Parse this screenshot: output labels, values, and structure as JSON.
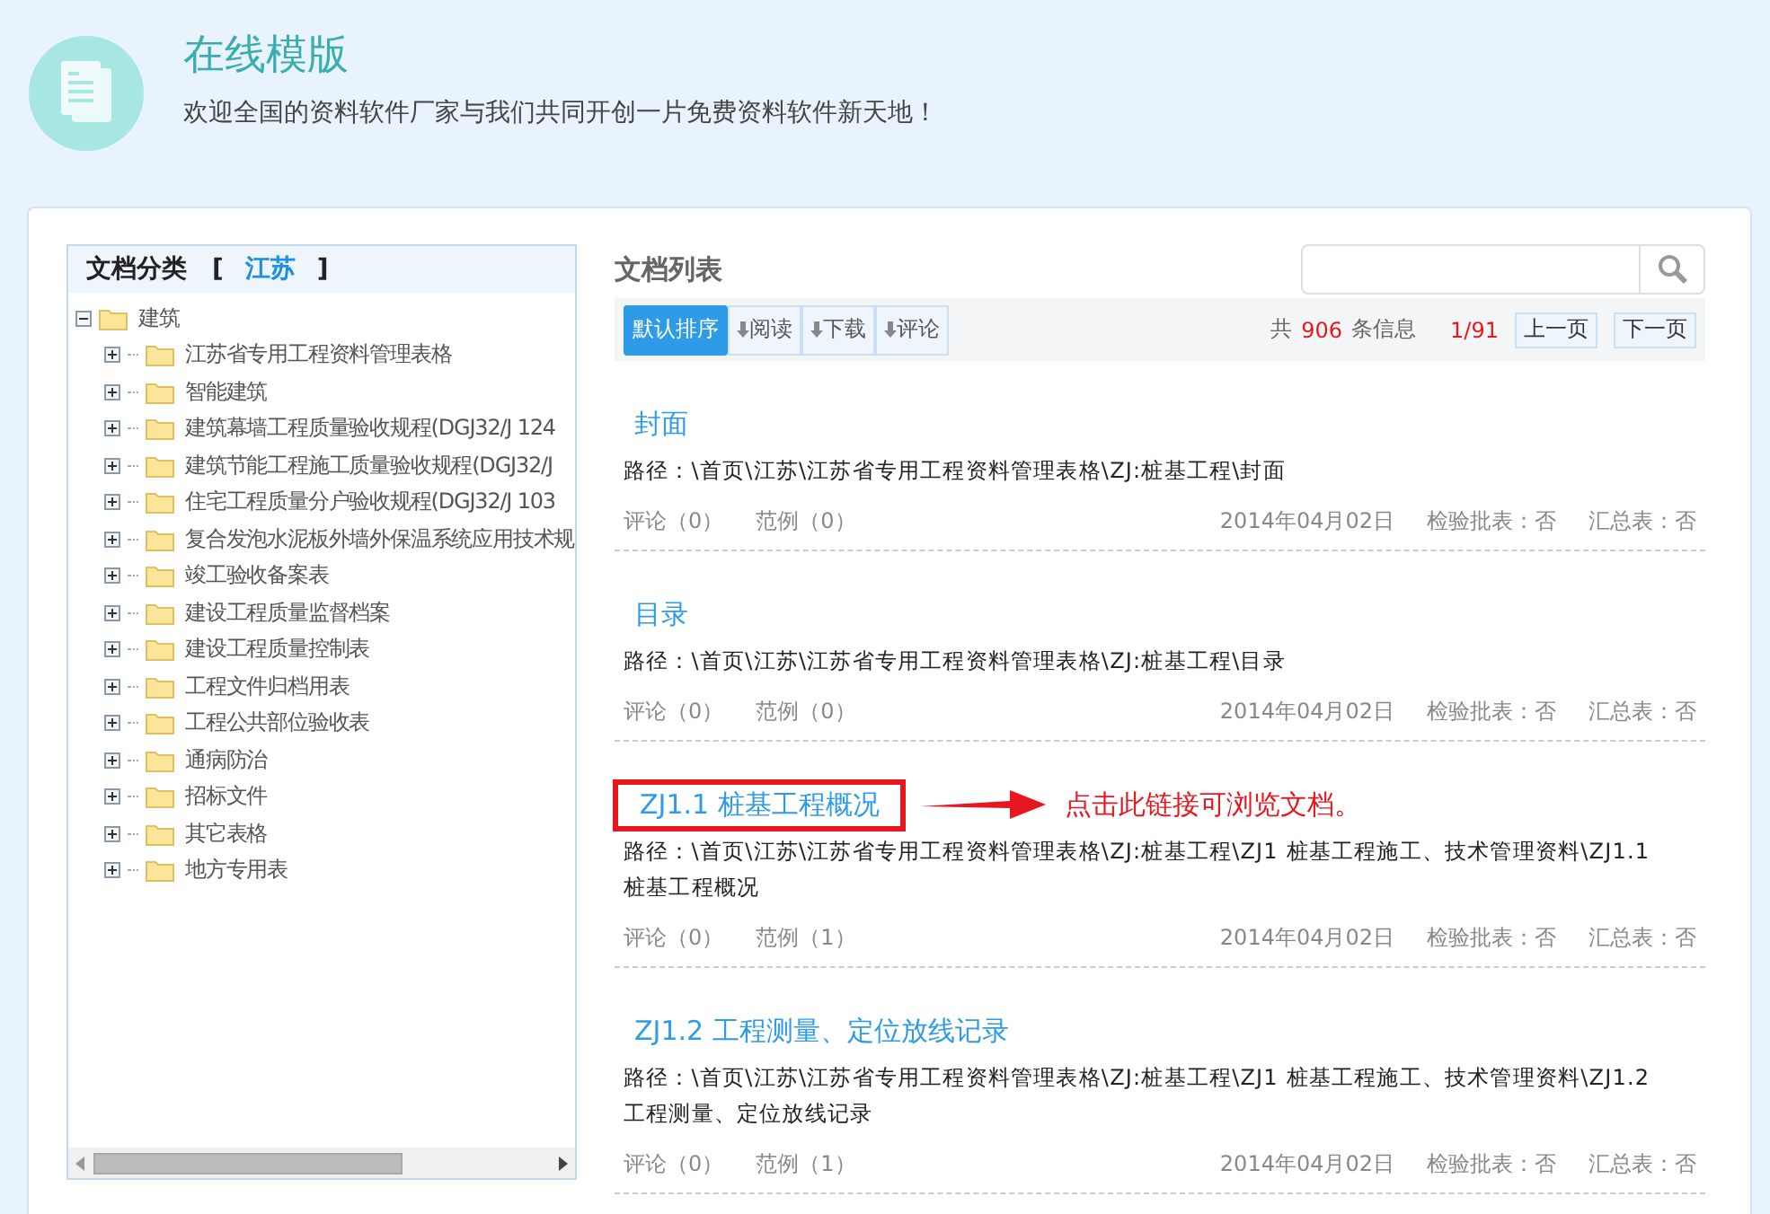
{
  "header": {
    "title": "在线模版",
    "subtitle": "欢迎全国的资料软件厂家与我们共同开创一片免费资料软件新天地！"
  },
  "sidebar": {
    "title": "文档分类",
    "region_open": "[",
    "region": "江苏",
    "region_close": "]",
    "tree": [
      {
        "label": "建筑",
        "expanded": true,
        "children": [
          {
            "label": "江苏省专用工程资料管理表格",
            "expanded": false
          },
          {
            "label": "智能建筑",
            "expanded": false
          },
          {
            "label": "建筑幕墙工程质量验收规程(DGJ32/J 124",
            "expanded": false
          },
          {
            "label": "建筑节能工程施工质量验收规程(DGJ32/J",
            "expanded": false
          },
          {
            "label": "住宅工程质量分户验收规程(DGJ32/J 103",
            "expanded": false
          },
          {
            "label": "复合发泡水泥板外墙外保温系统应用技术规",
            "expanded": false
          },
          {
            "label": "竣工验收备案表",
            "expanded": false
          },
          {
            "label": "建设工程质量监督档案",
            "expanded": false
          },
          {
            "label": "建设工程质量控制表",
            "expanded": false
          },
          {
            "label": "工程文件归档用表",
            "expanded": false
          },
          {
            "label": "工程公共部位验收表",
            "expanded": false
          },
          {
            "label": "通病防治",
            "expanded": false
          },
          {
            "label": "招标文件",
            "expanded": false
          },
          {
            "label": "其它表格",
            "expanded": false
          },
          {
            "label": "地方专用表",
            "expanded": false
          }
        ]
      }
    ]
  },
  "list": {
    "title": "文档列表",
    "sort_buttons": [
      {
        "label": "默认排序",
        "selected": true,
        "arrow": false
      },
      {
        "label": "阅读",
        "selected": false,
        "arrow": true
      },
      {
        "label": "下载",
        "selected": false,
        "arrow": true
      },
      {
        "label": "评论",
        "selected": false,
        "arrow": true
      }
    ],
    "pager": {
      "total_prefix": "共",
      "total": "906",
      "total_suffix": "条信息",
      "page": "1/91",
      "prev": "上一页",
      "next": "下一页"
    },
    "items": [
      {
        "title": "封面",
        "highlighted": false,
        "path": "路径：\\首页\\江苏\\江苏省专用工程资料管理表格\\ZJ:桩基工程\\封面",
        "comments": "评论（0）",
        "examples": "范例（0）",
        "date": "2014年04月02日",
        "inspection": "检验批表：否",
        "summary": "汇总表：否"
      },
      {
        "title": "目录",
        "highlighted": false,
        "path": "路径：\\首页\\江苏\\江苏省专用工程资料管理表格\\ZJ:桩基工程\\目录",
        "comments": "评论（0）",
        "examples": "范例（0）",
        "date": "2014年04月02日",
        "inspection": "检验批表：否",
        "summary": "汇总表：否"
      },
      {
        "title": "ZJ1.1 桩基工程概况",
        "highlighted": true,
        "callout": "点击此链接可浏览文档。",
        "path": "路径：\\首页\\江苏\\江苏省专用工程资料管理表格\\ZJ:桩基工程\\ZJ1 桩基工程施工、技术管理资料\\ZJ1.1 桩基工程概况",
        "comments": "评论（0）",
        "examples": "范例（1）",
        "date": "2014年04月02日",
        "inspection": "检验批表：否",
        "summary": "汇总表：否"
      },
      {
        "title": "ZJ1.2 工程测量、定位放线记录",
        "highlighted": false,
        "path": "路径：\\首页\\江苏\\江苏省专用工程资料管理表格\\ZJ:桩基工程\\ZJ1 桩基工程施工、技术管理资料\\ZJ1.2 工程测量、定位放线记录",
        "comments": "评论（0）",
        "examples": "范例（1）",
        "date": "2014年04月02日",
        "inspection": "检验批表：否",
        "summary": "汇总表：否"
      }
    ]
  }
}
